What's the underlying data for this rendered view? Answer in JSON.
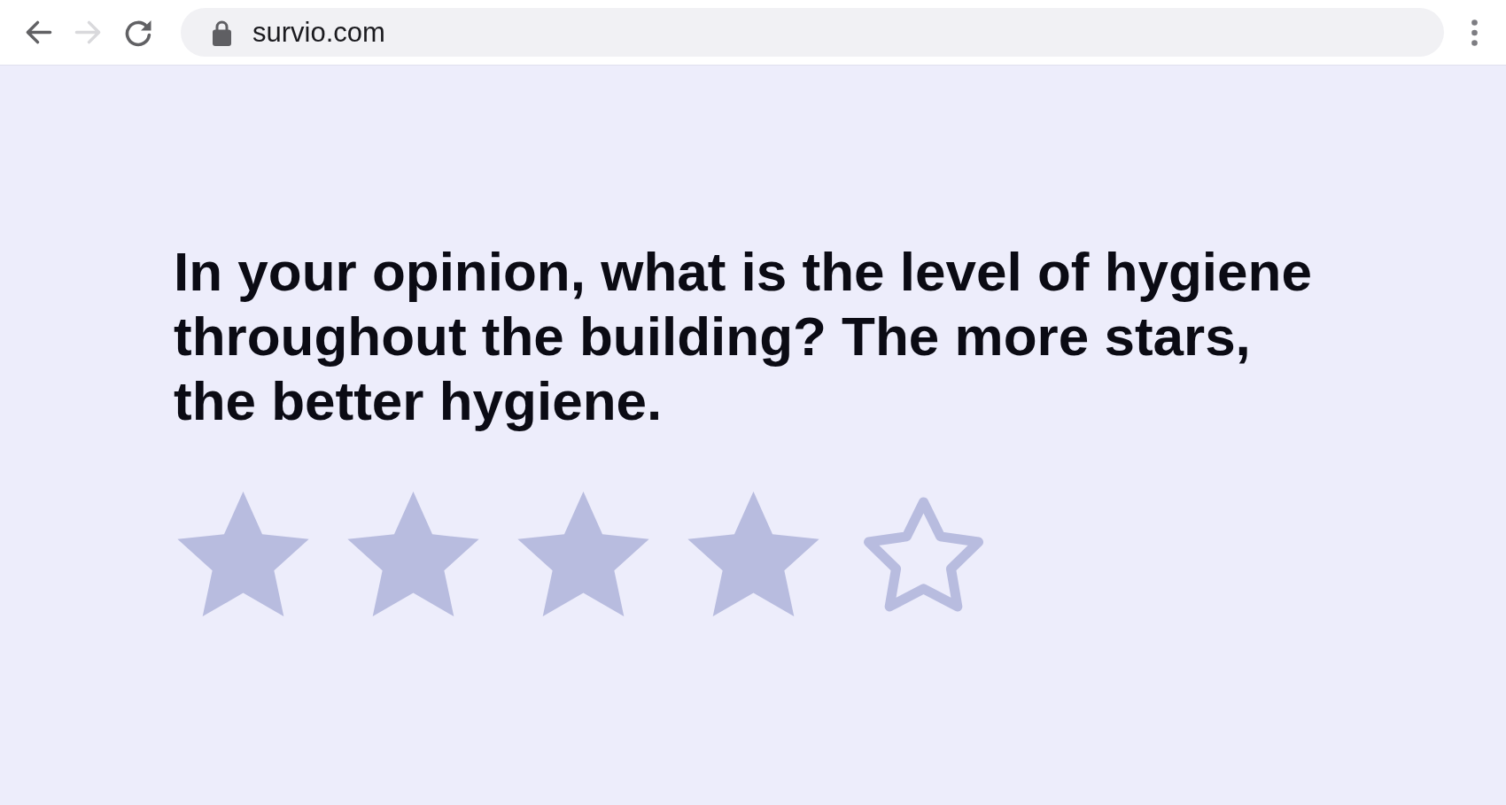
{
  "browser": {
    "navigation": [
      {
        "kind": "back",
        "disabled": false
      },
      {
        "kind": "forward",
        "disabled": true
      },
      {
        "kind": "reload",
        "disabled": false
      }
    ],
    "address_bar": {
      "secure": true,
      "url": "survio.com"
    }
  },
  "question": {
    "text": "In your opinion, what is the level of hygiene throughout the building? The more stars, the better hygiene.",
    "rating": {
      "stars": 4
    }
  }
}
